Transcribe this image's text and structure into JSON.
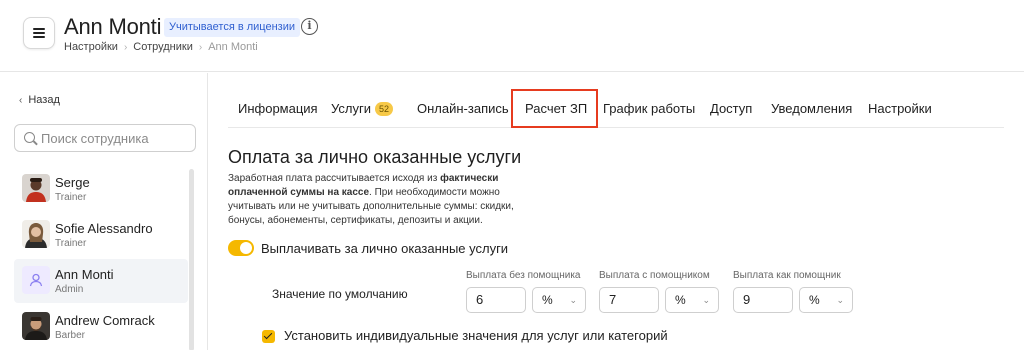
{
  "header": {
    "title": "Ann Monti",
    "license_badge": "Учитывается в лицензии",
    "breadcrumb": [
      "Настройки",
      "Сотрудники",
      "Ann Monti"
    ]
  },
  "sidebar": {
    "back_label": "Назад",
    "search_placeholder": "Поиск сотрудника",
    "employees": [
      {
        "name": "Serge",
        "role": "Trainer",
        "active": false
      },
      {
        "name": "Sofie Alessandro",
        "role": "Trainer",
        "active": false
      },
      {
        "name": "Ann Monti",
        "role": "Admin",
        "active": true
      },
      {
        "name": "Andrew Comrack",
        "role": "Barber",
        "active": false
      }
    ]
  },
  "tabs": [
    {
      "label": "Информация"
    },
    {
      "label": "Услуги",
      "badge": "52"
    },
    {
      "label": "Онлайн-запись"
    },
    {
      "label": "Расчет ЗП",
      "highlighted": true
    },
    {
      "label": "График работы"
    },
    {
      "label": "Доступ"
    },
    {
      "label": "Уведомления"
    },
    {
      "label": "Настройки"
    }
  ],
  "main": {
    "section_title": "Оплата за лично оказанные услуги",
    "desc_part1": "Заработная плата рассчитывается исходя из ",
    "desc_bold": "фактически оплаченной суммы на кассе",
    "desc_part2": ". При необходимости можно учитывать или не учитывать дополнительные суммы: скидки, бонусы, абонементы, сертификаты, депозиты и акции.",
    "toggle_label": "Выплачивать за лично оказанные услуги",
    "toggle_on": true,
    "default_label": "Значение по умолчанию",
    "columns": [
      {
        "label": "Выплата без помощника",
        "value": "6",
        "unit": "%"
      },
      {
        "label": "Выплата с помощником",
        "value": "7",
        "unit": "%"
      },
      {
        "label": "Выплата как помощник",
        "value": "9",
        "unit": "%"
      }
    ],
    "checkbox_label": "Установить индивидуальные значения для услуг или категорий",
    "checkbox_checked": true
  },
  "colors": {
    "accent": "#f5b800",
    "highlight_border": "#e63b1f",
    "badge_bg": "#e8efff",
    "badge_text": "#2f5fd0"
  }
}
